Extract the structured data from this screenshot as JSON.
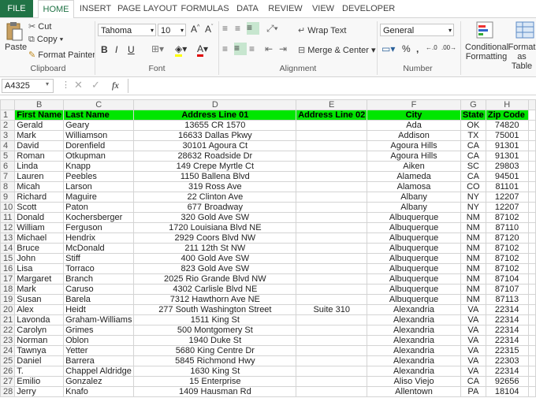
{
  "tabs": [
    "FILE",
    "HOME",
    "INSERT",
    "PAGE LAYOUT",
    "FORMULAS",
    "DATA",
    "REVIEW",
    "VIEW",
    "DEVELOPER"
  ],
  "ribbon": {
    "clipboard": {
      "paste": "Paste",
      "cut": "Cut",
      "copy": "Copy",
      "format_painter": "Format Painter",
      "label": "Clipboard"
    },
    "font": {
      "name": "Tahoma",
      "size": "10",
      "bold": "B",
      "italic": "I",
      "underline": "U",
      "label": "Font"
    },
    "alignment": {
      "wrap_text": "Wrap Text",
      "merge_center": "Merge & Center",
      "label": "Alignment"
    },
    "number": {
      "format": "General",
      "percent": "%",
      "comma": ",",
      "label": "Number"
    },
    "styles": {
      "conditional_formatting": "Conditional Formatting",
      "format_as_table": "Format as Table"
    }
  },
  "formula_bar": {
    "name_box": "A4325",
    "fx": "fx",
    "value": ""
  },
  "columns": [
    "B",
    "C",
    "D",
    "E",
    "F",
    "G",
    "H"
  ],
  "header": [
    "First Name",
    "Last Name",
    "Address Line 01",
    "Address Line 02",
    "City",
    "State",
    "Zip Code"
  ],
  "rows": [
    [
      "2",
      "Gerald",
      "Geary",
      "13655 CR 1570",
      "",
      "Ada",
      "OK",
      "74820"
    ],
    [
      "3",
      "Mark",
      "Williamson",
      "16633 Dallas Pkwy",
      "",
      "Addison",
      "TX",
      "75001"
    ],
    [
      "4",
      "David",
      "Dorenfield",
      "30101 Agoura Ct",
      "",
      "Agoura Hills",
      "CA",
      "91301"
    ],
    [
      "5",
      "Roman",
      "Otkupman",
      "28632 Roadside Dr",
      "",
      "Agoura Hills",
      "CA",
      "91301"
    ],
    [
      "6",
      "Linda",
      "Knapp",
      "149 Crepe Myrtle Ct",
      "",
      "Aiken",
      "SC",
      "29803"
    ],
    [
      "7",
      "Lauren",
      "Peebles",
      "1150 Ballena Blvd",
      "",
      "Alameda",
      "CA",
      "94501"
    ],
    [
      "8",
      "Micah",
      "Larson",
      "319 Ross Ave",
      "",
      "Alamosa",
      "CO",
      "81101"
    ],
    [
      "9",
      "Richard",
      "Maguire",
      "22 Clinton Ave",
      "",
      "Albany",
      "NY",
      "12207"
    ],
    [
      "10",
      "Scott",
      "Paton",
      "677 Broadway",
      "",
      "Albany",
      "NY",
      "12207"
    ],
    [
      "11",
      "Donald",
      "Kochersberger",
      "320 Gold Ave SW",
      "",
      "Albuquerque",
      "NM",
      "87102"
    ],
    [
      "12",
      "William",
      "Ferguson",
      "1720 Louisiana Blvd NE",
      "",
      "Albuquerque",
      "NM",
      "87110"
    ],
    [
      "13",
      "Michael",
      "Hendrix",
      "2929 Coors Blvd NW",
      "",
      "Albuquerque",
      "NM",
      "87120"
    ],
    [
      "14",
      "Bruce",
      "McDonald",
      "211 12th St NW",
      "",
      "Albuquerque",
      "NM",
      "87102"
    ],
    [
      "15",
      "John",
      "Stiff",
      "400 Gold Ave SW",
      "",
      "Albuquerque",
      "NM",
      "87102"
    ],
    [
      "16",
      "Lisa",
      "Torraco",
      "823 Gold Ave SW",
      "",
      "Albuquerque",
      "NM",
      "87102"
    ],
    [
      "17",
      "Margaret",
      "Branch",
      "2025 Rio Grande Blvd NW",
      "",
      "Albuquerque",
      "NM",
      "87104"
    ],
    [
      "18",
      "Mark",
      "Caruso",
      "4302 Carlisle Blvd NE",
      "",
      "Albuquerque",
      "NM",
      "87107"
    ],
    [
      "19",
      "Susan",
      "Barela",
      "7312 Hawthorn Ave NE",
      "",
      "Albuquerque",
      "NM",
      "87113"
    ],
    [
      "20",
      "Alex",
      "Heidt",
      "277 South Washington Street",
      "Suite 310",
      "Alexandria",
      "VA",
      "22314"
    ],
    [
      "21",
      "Lavonda",
      "Graham-Williams",
      "1511 King St",
      "",
      "Alexandria",
      "VA",
      "22314"
    ],
    [
      "22",
      "Carolyn",
      "Grimes",
      "500 Montgomery St",
      "",
      "Alexandria",
      "VA",
      "22314"
    ],
    [
      "23",
      "Norman",
      "Oblon",
      "1940 Duke St",
      "",
      "Alexandria",
      "VA",
      "22314"
    ],
    [
      "24",
      "Tawnya",
      "Yetter",
      "5680 King Centre Dr",
      "",
      "Alexandria",
      "VA",
      "22315"
    ],
    [
      "25",
      "Daniel",
      "Barrera",
      "5845 Richmond Hwy",
      "",
      "Alexandria",
      "VA",
      "22303"
    ],
    [
      "26",
      "T.",
      "Chappel Aldridge",
      "1630 King St",
      "",
      "Alexandria",
      "VA",
      "22314"
    ],
    [
      "27",
      "Emilio",
      "Gonzalez",
      "15 Enterprise",
      "",
      "Aliso Viejo",
      "CA",
      "92656"
    ],
    [
      "28",
      "Jerry",
      "Knafo",
      "1409 Hausman Rd",
      "",
      "Allentown",
      "PA",
      "18104"
    ]
  ]
}
